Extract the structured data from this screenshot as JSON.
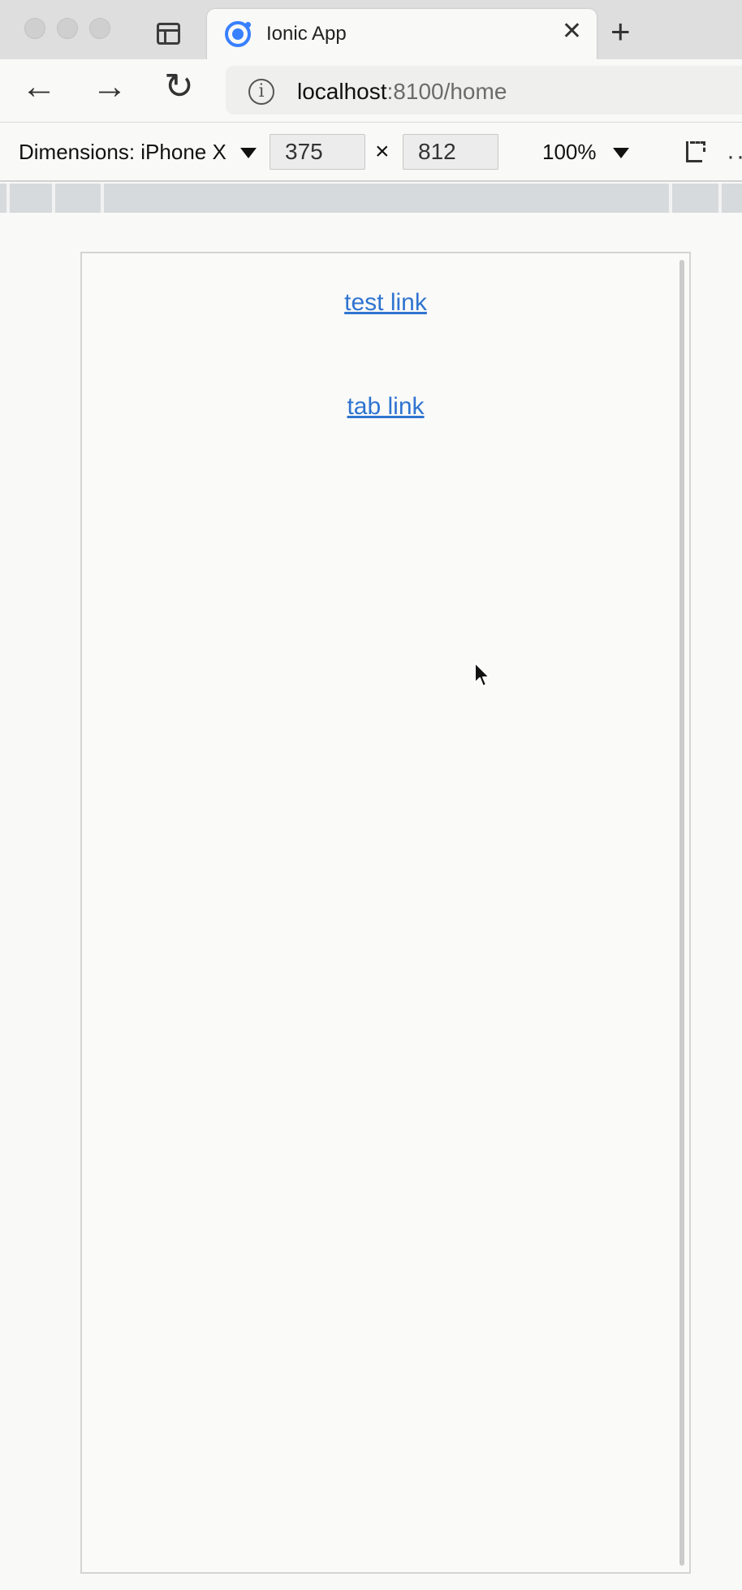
{
  "browser": {
    "tab": {
      "title": "Ionic App"
    },
    "url": {
      "host": "localhost",
      "rest": ":8100/home"
    }
  },
  "devtools": {
    "dimensions_label": "Dimensions: iPhone X",
    "width_value": "375",
    "times": "×",
    "height_value": "812",
    "zoom": "100%"
  },
  "app": {
    "links": [
      {
        "label": "test link"
      },
      {
        "label": "tab link"
      }
    ]
  },
  "colors": {
    "link": "#2f74d0",
    "ionic_brand": "#3880ff"
  },
  "icons": {
    "back": "arrow-left-icon",
    "forward": "arrow-right-icon",
    "reload": "reload-icon",
    "new_tab": "plus-icon",
    "close_tab": "close-icon",
    "info": "info-icon"
  }
}
